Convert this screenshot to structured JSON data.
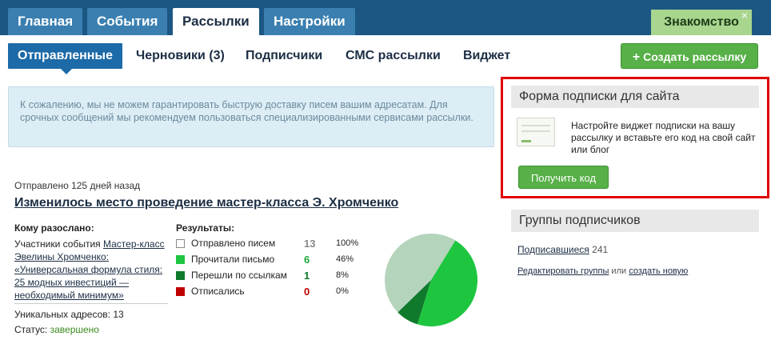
{
  "top_tabs": [
    {
      "label": "Главная"
    },
    {
      "label": "События"
    },
    {
      "label": "Рассылки"
    },
    {
      "label": "Настройки"
    }
  ],
  "intro_button": "Знакомство",
  "intro_close": "×",
  "sub_tabs": [
    {
      "label": "Отправленные"
    },
    {
      "label": "Черновики (3)"
    },
    {
      "label": "Подписчики"
    },
    {
      "label": "СМС рассылки"
    },
    {
      "label": "Виджет"
    }
  ],
  "create_button": {
    "icon": "+",
    "label": "Создать рассылку"
  },
  "notice": "К сожалению, мы не можем гарантировать быструю доставку писем вашим адресатам. Для срочных сообщений мы рекомендуем пользоваться специализированными сервисами рассылки.",
  "mailing": {
    "sent_ago": "Отправлено 125 дней назад",
    "title": "Изменилось место проведение мастер-класса Э. Хромченко",
    "recipients_label": "Кому разослано:",
    "recipients_prefix": "Участники события ",
    "recipients_link": "Мастер-класс Эвелины Хромченко: «Универсальная формула стиля: 25 модных инвестиций — необходимый минимум»",
    "unique": "Уникальных адресов: 13",
    "status_label": "Статус: ",
    "status_value": "завершено",
    "results_label": "Результаты:",
    "results": [
      {
        "label": "Отправлено писем",
        "count": "13",
        "pct": "100%",
        "color": "#ffffff",
        "num_color": "#888888"
      },
      {
        "label": "Прочитали письмо",
        "count": "6",
        "pct": "46%",
        "color": "#1ec640",
        "num_color": "#1ea838"
      },
      {
        "label": "Перешли по ссылкам",
        "count": "1",
        "pct": "8%",
        "color": "#0f7a2c",
        "num_color": "#0f7a2c"
      },
      {
        "label": "Отписались",
        "count": "0",
        "pct": "0%",
        "color": "#c00000",
        "num_color": "#c00000"
      }
    ]
  },
  "chart_data": {
    "type": "pie",
    "slices": [
      {
        "value": 46,
        "color": "#1ec640"
      },
      {
        "value": 8,
        "color": "#0f7a2c"
      },
      {
        "value": 46,
        "color": "#b4d4bc"
      }
    ]
  },
  "widget_panel": {
    "title": "Форма подписки для сайта",
    "text": "Настройте виджет подписки на вашу рассылку и вставьте его код на свой сайт или блог",
    "button": "Получить код"
  },
  "groups_panel": {
    "title": "Группы подписчиков",
    "subscribed_link": "Подписавшиеся",
    "subscribed_count": "241",
    "edit_link": "Редактировать группы",
    "or_text": " или ",
    "create_link": "создать новую"
  }
}
